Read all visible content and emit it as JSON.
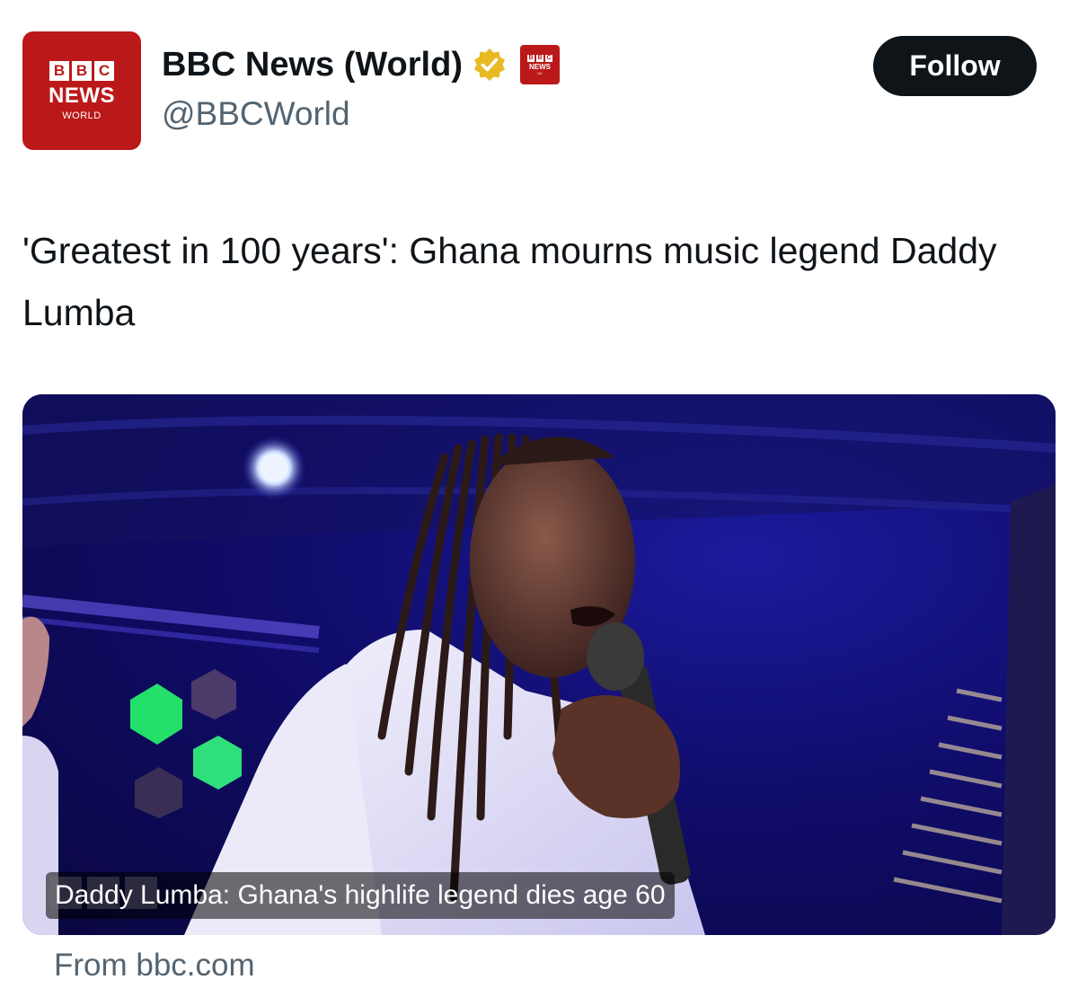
{
  "account": {
    "display_name": "BBC News (World)",
    "handle": "@BBCWorld",
    "avatar": {
      "blocks": [
        "B",
        "B",
        "C"
      ],
      "line1": "NEWS",
      "line2": "WORLD"
    },
    "affiliate_badge": {
      "blocks": [
        "B",
        "B",
        "C"
      ],
      "line1": "NEWS",
      "line2": "UK"
    },
    "verified_badge": "gold-verified-icon"
  },
  "follow_button": {
    "label": "Follow"
  },
  "tweet": {
    "text": "'Greatest in 100 years': Ghana mourns music legend Daddy Lumba"
  },
  "link_card": {
    "caption": "Daddy Lumba: Ghana's highlife legend dies age 60",
    "watermark": "BBC NEWS",
    "source": "From bbc.com"
  },
  "colors": {
    "bbc_red": "#bb1919",
    "follow_bg": "#0f1419",
    "secondary_text": "#536471",
    "verified_gold": "#e8b923"
  }
}
